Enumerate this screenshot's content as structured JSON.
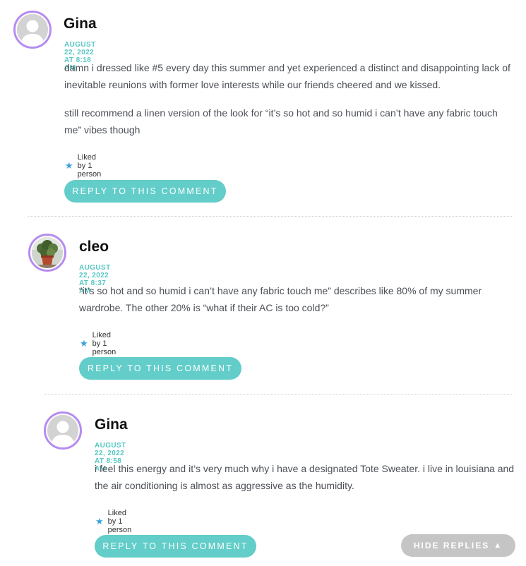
{
  "comments": [
    {
      "author": "Gina",
      "date": "AUGUST 22, 2022 AT 8:18 AM",
      "paragraphs": [
        "damn i dressed like #5 every day this summer and yet experienced a distinct and disappointing lack of inevitable reunions with former love interests while our friends cheered and we kissed.",
        "still recommend a linen version of the look for “it’s so hot and so humid i can’t have any fabric touch me” vibes though"
      ],
      "likes": "Liked by 1 person",
      "reply_label": "REPLY TO THIS COMMENT",
      "avatar_icon": "default-person-icon"
    },
    {
      "author": "cleo",
      "date": "AUGUST 22, 2022 AT 8:37 AM",
      "paragraphs": [
        "“it’s so hot and so humid i can’t have any fabric touch me” describes like 80% of my summer wardrobe. The other 20% is “what if their AC is too cold?”"
      ],
      "likes": "Liked by 1 person",
      "reply_label": "REPLY TO THIS COMMENT",
      "avatar_icon": "potted-plant-photo"
    },
    {
      "author": "Gina",
      "date": "AUGUST 22, 2022 AT 8:58 AM",
      "paragraphs": [
        "i feel this energy and it’s very much why i have a designated Tote Sweater. i live in louisiana and the air conditioning is almost as aggressive as the humidity."
      ],
      "likes": "Liked by 1 person",
      "reply_label": "REPLY TO THIS COMMENT",
      "avatar_icon": "default-person-icon"
    }
  ],
  "hide_replies_label": "HIDE REPLIES",
  "colors": {
    "accent": "#56c7c2",
    "button": "#62cdc9",
    "avatar_ring": "#b58cf0",
    "like_star": "#3aa0d8",
    "hide_button": "#c5c5c5"
  }
}
